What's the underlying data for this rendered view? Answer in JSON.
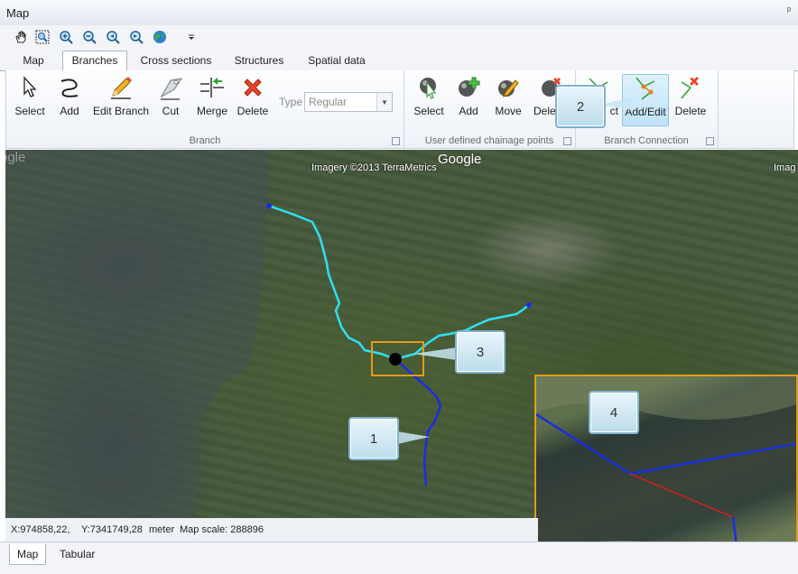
{
  "window": {
    "title": "Map",
    "pin": "ᵖ"
  },
  "quick_toolbar": {
    "icons": [
      "pan-hand-icon",
      "zoom-box-icon",
      "zoom-in-icon",
      "zoom-out-icon",
      "zoom-previous-icon",
      "zoom-next-icon",
      "globe-icon",
      "dropdown-arrow-icon"
    ]
  },
  "tabs": [
    "Map",
    "Branches",
    "Cross sections",
    "Structures",
    "Spatial data"
  ],
  "active_tab": "Branches",
  "ribbon": {
    "branch_group": {
      "label": "Branch",
      "buttons": [
        "Select",
        "Add",
        "Edit Branch",
        "Cut",
        "Merge",
        "Delete"
      ],
      "type_label": "Type",
      "type_value": "Regular"
    },
    "chainage_group": {
      "label": "User defined chainage points",
      "buttons": [
        "Select",
        "Add",
        "Move",
        "Dele"
      ]
    },
    "connection_group": {
      "label": "Branch Connection",
      "buttons": [
        "ct",
        "Add/Edit",
        "Delete"
      ]
    }
  },
  "map": {
    "watermarks": [
      "ogle",
      "Google"
    ],
    "imagery_text": "Imagery ©2013 TerraMetrics",
    "imagery_text_right": "Imag",
    "colors": {
      "branch": "#2ee0f0",
      "selected_branch": "#1a2ee0",
      "highlight": "#e39b1a",
      "connection": "#cc2222"
    }
  },
  "callouts": [
    "1",
    "2",
    "3",
    "4"
  ],
  "status": {
    "x": "X:974858,22,",
    "y": "Y:7341749,28",
    "unit": "meter",
    "scale": "Map scale: 288896"
  },
  "bottom_tabs": [
    "Map",
    "Tabular"
  ]
}
